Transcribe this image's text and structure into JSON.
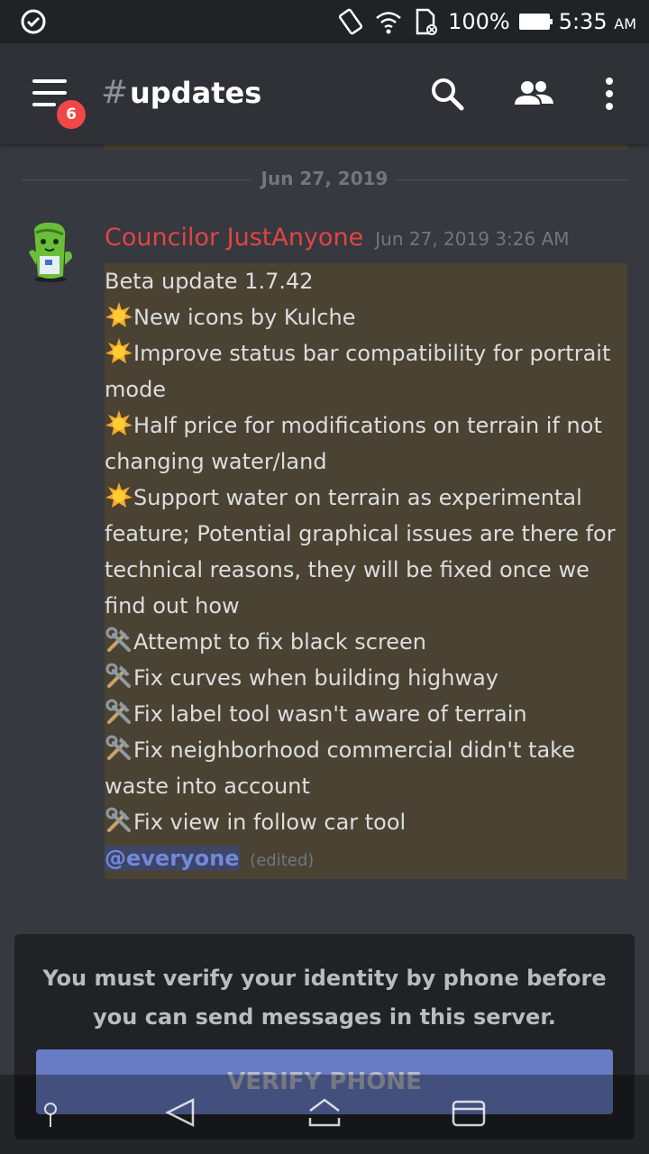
{
  "status_bar": {
    "battery": "100%",
    "time": "5:35",
    "ampm": "AM"
  },
  "app_bar": {
    "notification_count": "6",
    "channel_hash": "#",
    "channel_name": "updates"
  },
  "chat": {
    "date_divider": "Jun 27, 2019",
    "message": {
      "author": "Councilor JustAnyone",
      "author_color": "#e24442",
      "timestamp": "Jun 27, 2019 3:26 AM",
      "title": "Beta update 1.7.42",
      "items": [
        {
          "icon": "sun-emoji",
          "text": "New icons by Kulche"
        },
        {
          "icon": "sun-emoji",
          "text": "Improve status bar compatibility for portrait mode"
        },
        {
          "icon": "sun-emoji",
          "text": "Half price for modifications on terrain if not changing water/land"
        },
        {
          "icon": "sun-emoji",
          "text": "Support water on terrain as experimental feature; Potential graphical issues are there for technical reasons, they will be fixed once we find out how"
        },
        {
          "icon": "tools-emoji",
          "text": "Attempt to fix black screen"
        },
        {
          "icon": "tools-emoji",
          "text": "Fix curves when building highway"
        },
        {
          "icon": "tools-emoji",
          "text": "Fix label tool wasn't aware of terrain"
        },
        {
          "icon": "tools-emoji",
          "text": "Fix neighborhood commercial didn't take waste into account"
        },
        {
          "icon": "tools-emoji",
          "text": "Fix view in follow car tool"
        }
      ],
      "mention": "@everyone",
      "edited": "(edited)"
    }
  },
  "verify": {
    "message": "You must verify your identity by phone before you can send messages in this server.",
    "button_label": "VERIFY PHONE"
  },
  "colors": {
    "background": "#36393f",
    "highlight": "#4a4333",
    "accent": "#7289da"
  }
}
